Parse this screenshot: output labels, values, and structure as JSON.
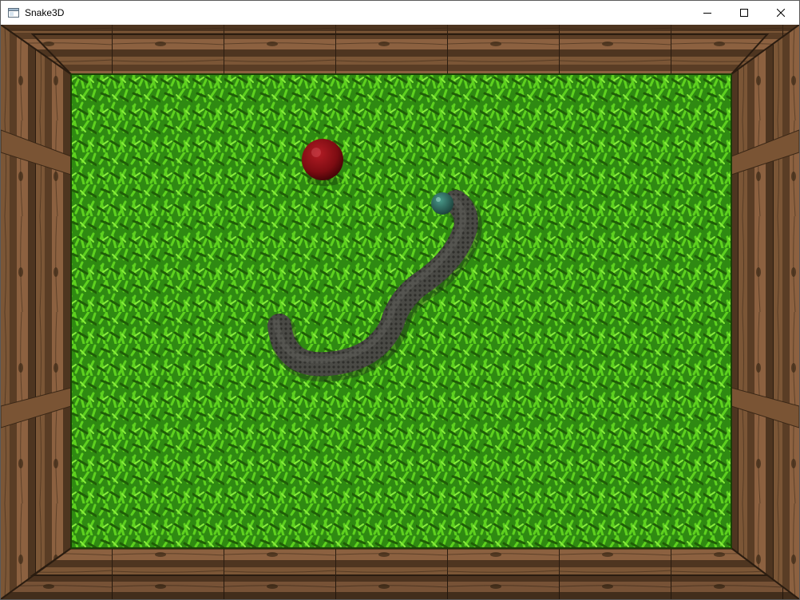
{
  "window": {
    "title": "Snake3D",
    "app_icon": "window-app-icon",
    "controls": {
      "minimize_icon": "minimize-icon",
      "maximize_icon": "maximize-icon",
      "close_icon": "close-icon"
    }
  },
  "scene": {
    "board_texture": "grass",
    "frame_texture": "wood",
    "food_color": "#8b0f16",
    "snake_body_color": "#4a4a45",
    "snake_head_color": "#2c6a60"
  }
}
